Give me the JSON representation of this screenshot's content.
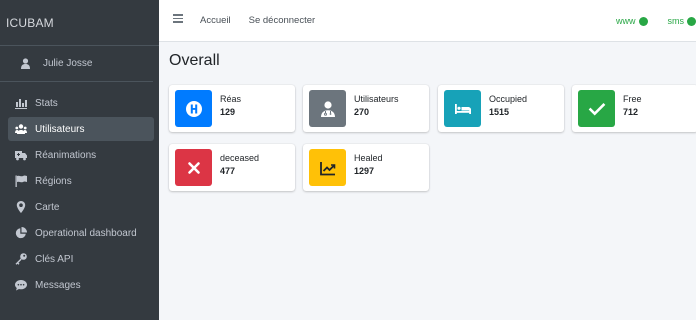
{
  "brand": "ICUBAM",
  "user": {
    "name": "Julie Josse",
    "icon": "user-icon"
  },
  "sidebar": {
    "items": [
      {
        "label": "Stats",
        "icon": "stats-icon"
      },
      {
        "label": "Utilisateurs",
        "icon": "users-icon",
        "active": true
      },
      {
        "label": "Réanimations",
        "icon": "ambulance-icon"
      },
      {
        "label": "Régions",
        "icon": "flag-icon"
      },
      {
        "label": "Carte",
        "icon": "map-marker-icon"
      },
      {
        "label": "Operational dashboard",
        "icon": "pie-chart-icon"
      },
      {
        "label": "Clés API",
        "icon": "key-icon"
      },
      {
        "label": "Messages",
        "icon": "comment-icon"
      }
    ]
  },
  "topbar": {
    "menu_icon": "hamburger-icon",
    "links": [
      "Accueil",
      "Se déconnecter"
    ],
    "statuses": [
      {
        "label": "www",
        "color": "#28a745"
      },
      {
        "label": "sms",
        "color": "#28a745"
      }
    ]
  },
  "main": {
    "title": "Overall",
    "cards": [
      {
        "label": "Réas",
        "value": "129",
        "color": "#007bff",
        "icon": "hospital-icon"
      },
      {
        "label": "Utilisateurs",
        "value": "270",
        "color": "#6c757d",
        "icon": "doctor-icon"
      },
      {
        "label": "Occupied",
        "value": "1515",
        "color": "#17a2b8",
        "icon": "bed-icon"
      },
      {
        "label": "Free",
        "value": "712",
        "color": "#28a745",
        "icon": "check-icon"
      },
      {
        "label": "deceased",
        "value": "477",
        "color": "#dc3545",
        "icon": "times-icon"
      },
      {
        "label": "Healed",
        "value": "1297",
        "color": "#ffc107",
        "icon": "chart-line-icon"
      }
    ]
  }
}
